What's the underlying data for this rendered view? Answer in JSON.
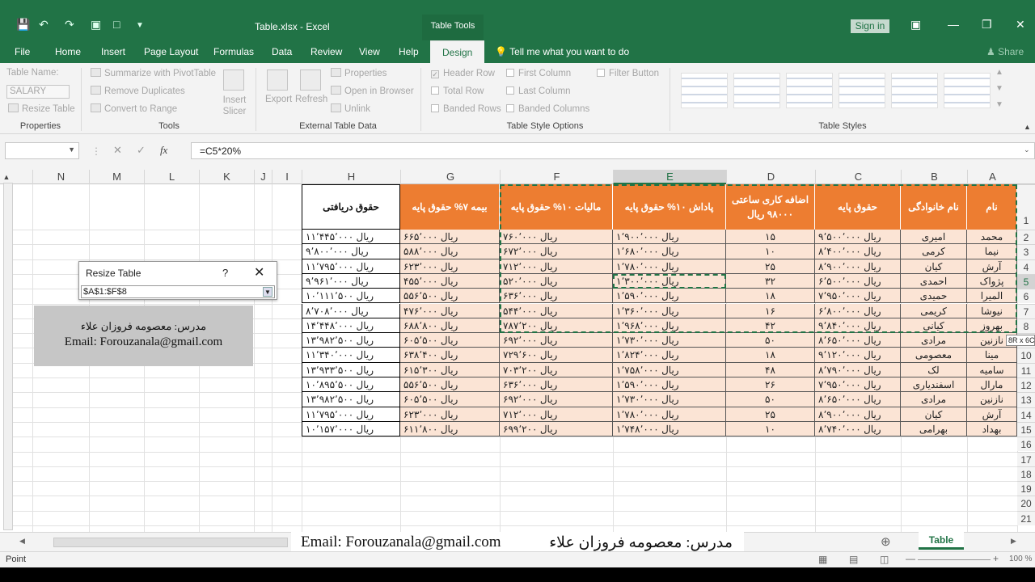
{
  "window": {
    "file_title": "Table.xlsx  -  Excel",
    "context_tab": "Table Tools",
    "sign_in": "Sign in"
  },
  "tabs": [
    "File",
    "Home",
    "Insert",
    "Page Layout",
    "Formulas",
    "Data",
    "Review",
    "View",
    "Help",
    "Design"
  ],
  "active_tab": "Design",
  "tell_me": "Tell me what you want to do",
  "share": "Share",
  "ribbon": {
    "properties": {
      "table_name_label": "Table Name:",
      "table_name_value": "SALARY",
      "resize": "Resize Table",
      "group": "Properties"
    },
    "tools": {
      "summarize": "Summarize with PivotTable",
      "remove_dup": "Remove Duplicates",
      "convert": "Convert to Range",
      "slicer": "Insert\nSlicer",
      "group": "Tools"
    },
    "external": {
      "export": "Export",
      "refresh": "Refresh",
      "properties": "Properties",
      "open_browser": "Open in Browser",
      "unlink": "Unlink",
      "group": "External Table Data"
    },
    "style_options": {
      "header_row": "Header Row",
      "total_row": "Total Row",
      "banded_rows": "Banded Rows",
      "first_col": "First Column",
      "last_col": "Last Column",
      "banded_cols": "Banded Columns",
      "filter_btn": "Filter Button",
      "group": "Table Style Options"
    },
    "styles": {
      "group": "Table Styles"
    }
  },
  "formula_bar": {
    "formula": "=C5*20%",
    "fx": "fx"
  },
  "columns": [
    "N",
    "M",
    "L",
    "K",
    "J",
    "I",
    "H",
    "G",
    "F",
    "E",
    "D",
    "C",
    "B",
    "A"
  ],
  "selected_column": "E",
  "rows": [
    "1",
    "2",
    "3",
    "4",
    "5",
    "6",
    "7",
    "8",
    "9",
    "10",
    "11",
    "12",
    "13",
    "14",
    "15",
    "16",
    "17",
    "18",
    "19",
    "20",
    "21"
  ],
  "selected_row": "5",
  "table": {
    "headers": {
      "A": "نام",
      "B": "نام خانوادگی",
      "C": "حقوق پایه",
      "D": "اضافه کاری ساعتی ۹۸۰۰۰ ریال",
      "E": "پاداش ۱۰% حقوق پایه",
      "F": "مالیات ۱۰% حقوق پایه",
      "G": "بیمه ۷% حقوق پایه",
      "H": "حقوق دریافتی"
    },
    "rows": [
      {
        "A": "محمد",
        "B": "امیری",
        "C": "ریال ۹٬۵۰۰٬۰۰۰",
        "D": "۱۵",
        "E": "ریال ۱٬۹۰۰٬۰۰۰",
        "F": "ریال ۷۶۰٬۰۰۰",
        "G": "ریال ۶۶۵٬۰۰۰",
        "H": "ریال ۱۱٬۴۴۵٬۰۰۰"
      },
      {
        "A": "نیما",
        "B": "کرمی",
        "C": "ریال ۸٬۴۰۰٬۰۰۰",
        "D": "۱۰",
        "E": "ریال ۱٬۶۸۰٬۰۰۰",
        "F": "ریال ۶۷۲٬۰۰۰",
        "G": "ریال ۵۸۸٬۰۰۰",
        "H": "ریال ۹٬۸۰۰٬۰۰۰"
      },
      {
        "A": "آرش",
        "B": "کیان",
        "C": "ریال ۸٬۹۰۰٬۰۰۰",
        "D": "۲۵",
        "E": "ریال ۱٬۷۸۰٬۰۰۰",
        "F": "ریال ۷۱۲٬۰۰۰",
        "G": "ریال ۶۲۳٬۰۰۰",
        "H": "ریال ۱۱٬۷۹۵٬۰۰۰"
      },
      {
        "A": "پژواک",
        "B": "احمدی",
        "C": "ریال ۶٬۵۰۰٬۰۰۰",
        "D": "۳۲",
        "E": "ریال ۱٬۳۰۰٬۰۰۰",
        "F": "ریال ۵۲۰٬۰۰۰",
        "G": "ریال ۴۵۵٬۰۰۰",
        "H": "ریال ۹٬۹۶۱٬۰۰۰"
      },
      {
        "A": "المیرا",
        "B": "حمیدی",
        "C": "ریال ۷٬۹۵۰٬۰۰۰",
        "D": "۱۸",
        "E": "ریال ۱٬۵۹۰٬۰۰۰",
        "F": "ریال ۶۳۶٬۰۰۰",
        "G": "ریال ۵۵۶٬۵۰۰",
        "H": "ریال ۱۰٬۱۱۱٬۵۰۰"
      },
      {
        "A": "نیوشا",
        "B": "کریمی",
        "C": "ریال ۶٬۸۰۰٬۰۰۰",
        "D": "۱۶",
        "E": "ریال ۱٬۳۶۰٬۰۰۰",
        "F": "ریال ۵۴۴٬۰۰۰",
        "G": "ریال ۴۷۶٬۰۰۰",
        "H": "ریال ۸٬۷۰۸٬۰۰۰"
      },
      {
        "A": "بهروز",
        "B": "کیانی",
        "C": "ریال ۹٬۸۴۰٬۰۰۰",
        "D": "۴۲",
        "E": "ریال ۱٬۹۶۸٬۰۰۰",
        "F": "ریال ۷۸۷٬۲۰۰",
        "G": "ریال ۶۸۸٬۸۰۰",
        "H": "ریال ۱۴٬۴۴۸٬۰۰۰"
      },
      {
        "A": "نازنین",
        "B": "مرادی",
        "C": "ریال ۸٬۶۵۰٬۰۰۰",
        "D": "۵۰",
        "E": "ریال ۱٬۷۳۰٬۰۰۰",
        "F": "ریال ۶۹۲٬۰۰۰",
        "G": "ریال ۶۰۵٬۵۰۰",
        "H": "ریال ۱۳٬۹۸۲٬۵۰۰"
      },
      {
        "A": "مینا",
        "B": "معصومی",
        "C": "ریال ۹٬۱۲۰٬۰۰۰",
        "D": "۱۸",
        "E": "ریال ۱٬۸۲۴٬۰۰۰",
        "F": "ریال ۷۲۹٬۶۰۰",
        "G": "ریال ۶۳۸٬۴۰۰",
        "H": "ریال ۱۱٬۳۴۰٬۰۰۰"
      },
      {
        "A": "سامیه",
        "B": "لک",
        "C": "ریال ۸٬۷۹۰٬۰۰۰",
        "D": "۴۸",
        "E": "ریال ۱٬۷۵۸٬۰۰۰",
        "F": "ریال ۷۰۳٬۲۰۰",
        "G": "ریال ۶۱۵٬۳۰۰",
        "H": "ریال ۱۳٬۹۳۳٬۵۰۰"
      },
      {
        "A": "مارال",
        "B": "اسفندیاری",
        "C": "ریال ۷٬۹۵۰٬۰۰۰",
        "D": "۲۶",
        "E": "ریال ۱٬۵۹۰٬۰۰۰",
        "F": "ریال ۶۳۶٬۰۰۰",
        "G": "ریال ۵۵۶٬۵۰۰",
        "H": "ریال ۱۰٬۸۹۵٬۵۰۰"
      },
      {
        "A": "نازنین",
        "B": "مرادی",
        "C": "ریال ۸٬۶۵۰٬۰۰۰",
        "D": "۵۰",
        "E": "ریال ۱٬۷۳۰٬۰۰۰",
        "F": "ریال ۶۹۲٬۰۰۰",
        "G": "ریال ۶۰۵٬۵۰۰",
        "H": "ریال ۱۳٬۹۸۲٬۵۰۰"
      },
      {
        "A": "آرش",
        "B": "کیان",
        "C": "ریال ۸٬۹۰۰٬۰۰۰",
        "D": "۲۵",
        "E": "ریال ۱٬۷۸۰٬۰۰۰",
        "F": "ریال ۷۱۲٬۰۰۰",
        "G": "ریال ۶۲۳٬۰۰۰",
        "H": "ریال ۱۱٬۷۹۵٬۰۰۰"
      },
      {
        "A": "بهداد",
        "B": "بهرامی",
        "C": "ریال ۸٬۷۴۰٬۰۰۰",
        "D": "۱۰",
        "E": "ریال ۱٬۷۴۸٬۰۰۰",
        "F": "ریال ۶۹۹٬۲۰۰",
        "G": "ریال ۶۱۱٬۸۰۰",
        "H": "ریال ۱۰٬۱۵۷٬۰۰۰"
      }
    ]
  },
  "resize_dialog": {
    "title": "Resize Table",
    "help": "?",
    "range": "$A$1:$F$8"
  },
  "size_tooltip": "8R x 6C",
  "watermark": {
    "teacher": "مدرس: معصومه فروزان علاء",
    "email": "Email: Forouzanala@gmail.com"
  },
  "sheet_tab": "Table",
  "status": {
    "mode": "Point",
    "zoom": "100 %"
  }
}
